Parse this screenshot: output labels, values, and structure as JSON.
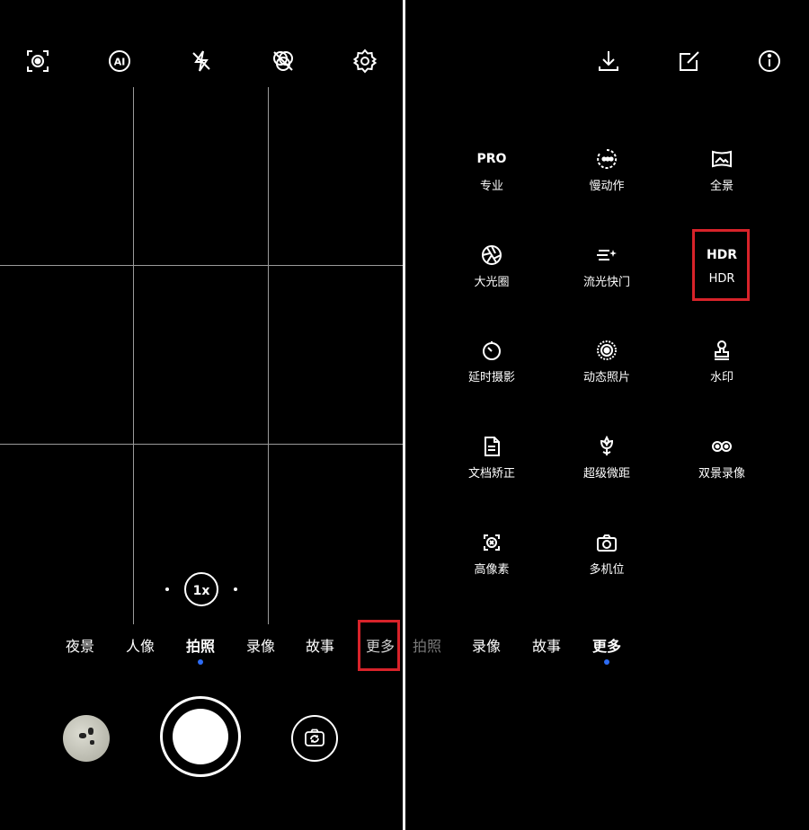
{
  "left": {
    "top_icons": [
      "ai-portrait-icon",
      "ai-icon",
      "flash-off-icon",
      "filter-icon",
      "gear-icon"
    ],
    "zoom": "1x",
    "modes": [
      {
        "label": "夜景",
        "active": false,
        "highlighted": false
      },
      {
        "label": "人像",
        "active": false,
        "highlighted": false
      },
      {
        "label": "拍照",
        "active": true,
        "highlighted": false
      },
      {
        "label": "录像",
        "active": false,
        "highlighted": false
      },
      {
        "label": "故事",
        "active": false,
        "highlighted": false
      },
      {
        "label": "更多",
        "active": false,
        "highlighted": true
      }
    ]
  },
  "right": {
    "top_icons": [
      "download-icon",
      "edit-icon",
      "info-icon"
    ],
    "tiles": [
      {
        "label": "专业",
        "icon": "PRO",
        "highlighted": false
      },
      {
        "label": "慢动作",
        "icon": "slow-motion-icon",
        "highlighted": false
      },
      {
        "label": "全景",
        "icon": "panorama-icon",
        "highlighted": false
      },
      {
        "label": "大光圈",
        "icon": "aperture-icon",
        "highlighted": false
      },
      {
        "label": "流光快门",
        "icon": "light-trail-icon",
        "highlighted": false
      },
      {
        "label": "HDR",
        "icon": "HDR",
        "highlighted": true
      },
      {
        "label": "延时摄影",
        "icon": "timer-icon",
        "highlighted": false
      },
      {
        "label": "动态照片",
        "icon": "live-photo-icon",
        "highlighted": false
      },
      {
        "label": "水印",
        "icon": "stamp-icon",
        "highlighted": false
      },
      {
        "label": "文档矫正",
        "icon": "document-icon",
        "highlighted": false
      },
      {
        "label": "超级微距",
        "icon": "flower-icon",
        "highlighted": false
      },
      {
        "label": "双景录像",
        "icon": "dual-view-icon",
        "highlighted": false
      },
      {
        "label": "高像素",
        "icon": "high-res-icon",
        "highlighted": false
      },
      {
        "label": "多机位",
        "icon": "multi-camera-icon",
        "highlighted": false
      }
    ],
    "modes": [
      {
        "label": "拍照",
        "active": false,
        "dim": true
      },
      {
        "label": "录像",
        "active": false,
        "dim": false
      },
      {
        "label": "故事",
        "active": false,
        "dim": false
      },
      {
        "label": "更多",
        "active": true,
        "dim": false
      }
    ]
  },
  "colors": {
    "highlight": "#d8232a",
    "active_dot": "#2d6cf5"
  }
}
